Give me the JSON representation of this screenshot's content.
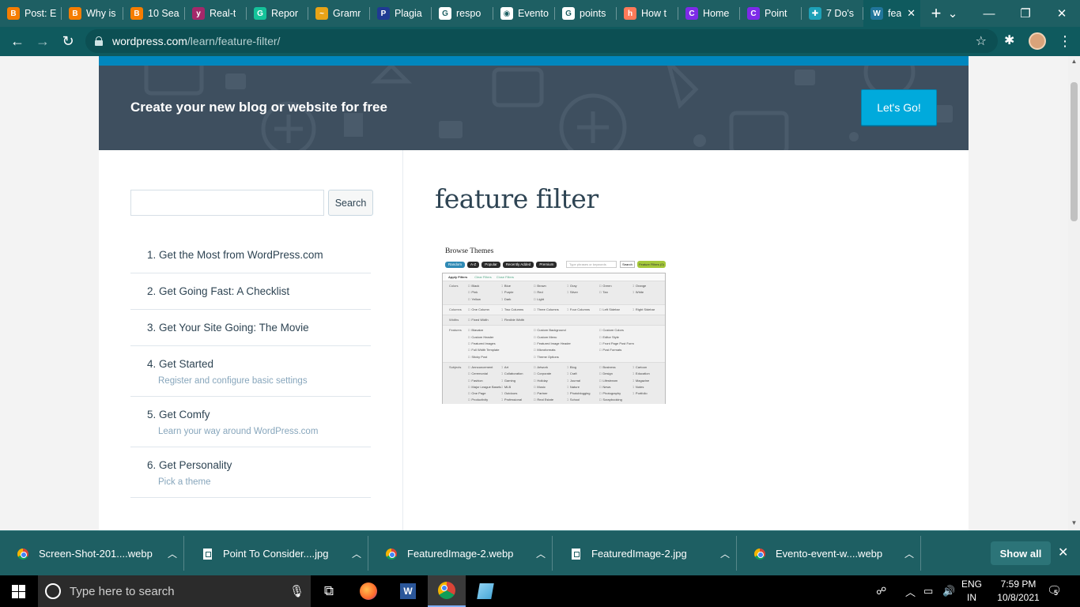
{
  "browser": {
    "tabs": [
      {
        "title": "Post: E",
        "icon": "blogger-icon",
        "color": "#f57d00",
        "glyph": "B"
      },
      {
        "title": "Why is",
        "icon": "blogger-icon",
        "color": "#f57d00",
        "glyph": "B"
      },
      {
        "title": "10 Sea",
        "icon": "blogger-icon",
        "color": "#f57d00",
        "glyph": "B"
      },
      {
        "title": "Real-t",
        "icon": "yoast-icon",
        "color": "#a4286a",
        "glyph": "y"
      },
      {
        "title": "Repor",
        "icon": "grammarly-icon",
        "color": "#15c39a",
        "glyph": "G"
      },
      {
        "title": "Gramr",
        "icon": "rainbow-icon",
        "color": "#e8a317",
        "glyph": "~"
      },
      {
        "title": "Plagia",
        "icon": "plagiarism-icon",
        "color": "#1f3a93",
        "glyph": "P"
      },
      {
        "title": "respo",
        "icon": "google-icon",
        "color": "#ffffff",
        "glyph": "G"
      },
      {
        "title": "Evento",
        "icon": "globe-icon",
        "color": "#ffffff",
        "glyph": "◉"
      },
      {
        "title": "points",
        "icon": "google-icon",
        "color": "#ffffff",
        "glyph": "G"
      },
      {
        "title": "How t",
        "icon": "hubspot-icon",
        "color": "#ff7a59",
        "glyph": "h"
      },
      {
        "title": "Home",
        "icon": "canva-icon",
        "color": "#7d2ae8",
        "glyph": "C"
      },
      {
        "title": "Point",
        "icon": "canva-icon",
        "color": "#7d2ae8",
        "glyph": "C"
      },
      {
        "title": "7 Do's",
        "icon": "puzzle-icon",
        "color": "#1da1b8",
        "glyph": "✚"
      },
      {
        "title": "fea",
        "icon": "wordpress-icon",
        "color": "#21759b",
        "glyph": "W",
        "active": true
      }
    ],
    "url_host": "wordpress.com",
    "url_path": "/learn/feature-filter/"
  },
  "banner": {
    "title": "Create your new blog or website for free",
    "cta": "Let's Go!"
  },
  "sidebar": {
    "search_placeholder": "",
    "search_button": "Search",
    "items": [
      {
        "num": "1.",
        "label": "Get the Most from WordPress.com",
        "sub": ""
      },
      {
        "num": "2.",
        "label": "Get Going Fast: A Checklist",
        "sub": ""
      },
      {
        "num": "3.",
        "label": "Get Your Site Going: The Movie",
        "sub": ""
      },
      {
        "num": "4.",
        "label": "Get Started",
        "sub": "Register and configure basic settings"
      },
      {
        "num": "5.",
        "label": "Get Comfy",
        "sub": "Learn your way around WordPress.com"
      },
      {
        "num": "6.",
        "label": "Get Personality",
        "sub": "Pick a theme"
      }
    ]
  },
  "main": {
    "title": "feature filter",
    "image": {
      "title": "Browse Themes",
      "pills": [
        "Random",
        "A-Z",
        "Popular",
        "Recently Added",
        "Premium"
      ],
      "search_placeholder": "Type phrases or keywords",
      "search_button": "Search",
      "feature_button": "Feature Filters (0)",
      "tabs": [
        "Apply Filters",
        "Clear Filters",
        "Close Filters"
      ],
      "rows": [
        {
          "label": "Colors",
          "cols": 6,
          "options": [
            "Black",
            "Blue",
            "Brown",
            "Gray",
            "Green",
            "Orange",
            "Pink",
            "Purple",
            "Red",
            "Silver",
            "Tan",
            "White",
            "Yellow",
            "Dark",
            "Light"
          ]
        },
        {
          "label": "Columns",
          "cols": 6,
          "options": [
            "One Column",
            "Two Columns",
            "Three Columns",
            "Four Columns",
            "Left Sidebar",
            "Right Sidebar"
          ]
        },
        {
          "label": "Widths",
          "cols": 6,
          "options": [
            "Fixed Width",
            "Flexible Width"
          ]
        },
        {
          "label": "Features",
          "cols": 3,
          "options": [
            "Blavatar",
            "Custom Background",
            "Custom Colors",
            "Custom Header",
            "Custom Menu",
            "Editor Style",
            "Featured Images",
            "Featured Image Header",
            "Front Page Post Form",
            "Full Width Template",
            "Microformats",
            "Post Formats",
            "Sticky Post",
            "Theme Options"
          ]
        },
        {
          "label": "Subjects",
          "cols": 6,
          "options": [
            "Announcement",
            "Art",
            "Artwork",
            "Blog",
            "Business",
            "Cartoon",
            "Ceremonial",
            "Collaboration",
            "Corporate",
            "Craft",
            "Design",
            "Education",
            "Fashion",
            "Gaming",
            "Holiday",
            "Journal",
            "Lifestream",
            "Magazine",
            "Major League Baseball",
            "MLB",
            "Music",
            "Nature",
            "News",
            "Notes",
            "One Page",
            "Outdoors",
            "Partner",
            "Photoblogging",
            "Photography",
            "Portfolio",
            "Productivity",
            "Professional",
            "Real Estate",
            "School",
            "Scrapbooking"
          ]
        }
      ]
    }
  },
  "downloads": {
    "items": [
      {
        "name": "Screen-Shot-201....webp",
        "type": "chrome"
      },
      {
        "name": "Point To Consider....jpg",
        "type": "file"
      },
      {
        "name": "FeaturedImage-2.webp",
        "type": "chrome"
      },
      {
        "name": "FeaturedImage-2.jpg",
        "type": "file"
      },
      {
        "name": "Evento-event-w....webp",
        "type": "chrome"
      }
    ],
    "show_all": "Show all"
  },
  "taskbar": {
    "search_placeholder": "Type here to search",
    "lang_top": "ENG",
    "lang_bottom": "IN",
    "time": "7:59 PM",
    "date": "10/8/2021",
    "notifications": "5"
  }
}
